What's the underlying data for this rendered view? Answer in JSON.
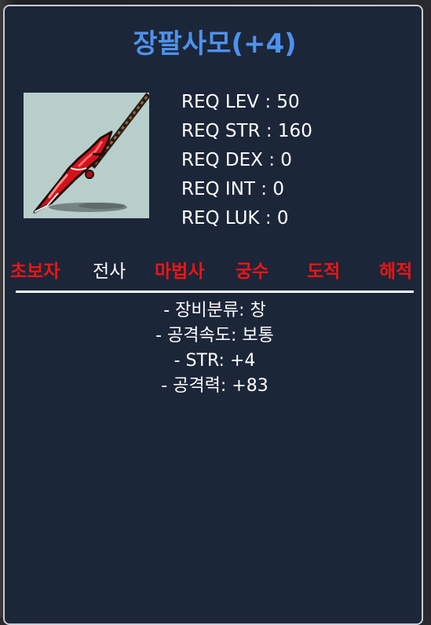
{
  "item": {
    "title": "장팔사모(+4)",
    "icon": "red-spear-icon"
  },
  "requirements": [
    "REQ LEV : 50",
    "REQ STR : 160",
    "REQ DEX : 0",
    "REQ INT : 0",
    "REQ LUK : 0"
  ],
  "jobs": [
    {
      "label": "초보자",
      "active": false
    },
    {
      "label": "전사",
      "active": true
    },
    {
      "label": "마법사",
      "active": false
    },
    {
      "label": "궁수",
      "active": false
    },
    {
      "label": "도적",
      "active": false
    },
    {
      "label": "해적",
      "active": false
    }
  ],
  "stats": [
    "- 장비분류: 창",
    "- 공격속도: 보통",
    "- STR: +4",
    "- 공격력: +83"
  ],
  "colors": {
    "title": "#4d92ee",
    "job_disabled": "#ee1414",
    "job_enabled": "#ffffff",
    "panel_bg": "#1c2639"
  }
}
